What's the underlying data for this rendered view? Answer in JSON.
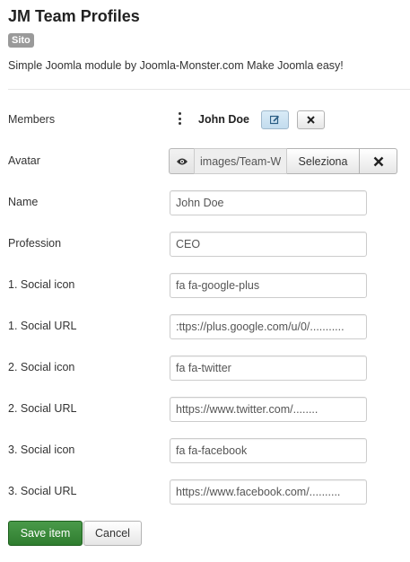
{
  "header": {
    "title": "JM Team Profiles",
    "badge": "Sito",
    "description": "Simple Joomla module by Joomla-Monster.com Make Joomla easy!"
  },
  "members": {
    "label": "Members",
    "name": "John Doe",
    "edit_icon": "edit-icon",
    "delete_icon": "close-icon"
  },
  "avatar": {
    "label": "Avatar",
    "preview_icon": "eye-icon",
    "path": "images/Team-W",
    "select_label": "Seleziona",
    "clear_icon": "close-icon"
  },
  "fields": {
    "name": {
      "label": "Name",
      "value": "John Doe"
    },
    "profession": {
      "label": "Profession",
      "value": "CEO"
    },
    "social_icon_1": {
      "label": "1. Social icon",
      "value": "fa fa-google-plus"
    },
    "social_url_1": {
      "label": "1. Social URL",
      "value": ":ttps://plus.google.com/u/0/..........."
    },
    "social_icon_2": {
      "label": "2. Social icon",
      "value": "fa fa-twitter"
    },
    "social_url_2": {
      "label": "2. Social URL",
      "value": "https://www.twitter.com/........"
    },
    "social_icon_3": {
      "label": "3. Social icon",
      "value": "fa fa-facebook"
    },
    "social_url_3": {
      "label": "3. Social URL",
      "value": "https://www.facebook.com/.........."
    }
  },
  "actions": {
    "save_label": "Save item",
    "cancel_label": "Cancel"
  },
  "colors": {
    "save_button": "#3a8a3a",
    "badge": "#9a9a9a"
  }
}
